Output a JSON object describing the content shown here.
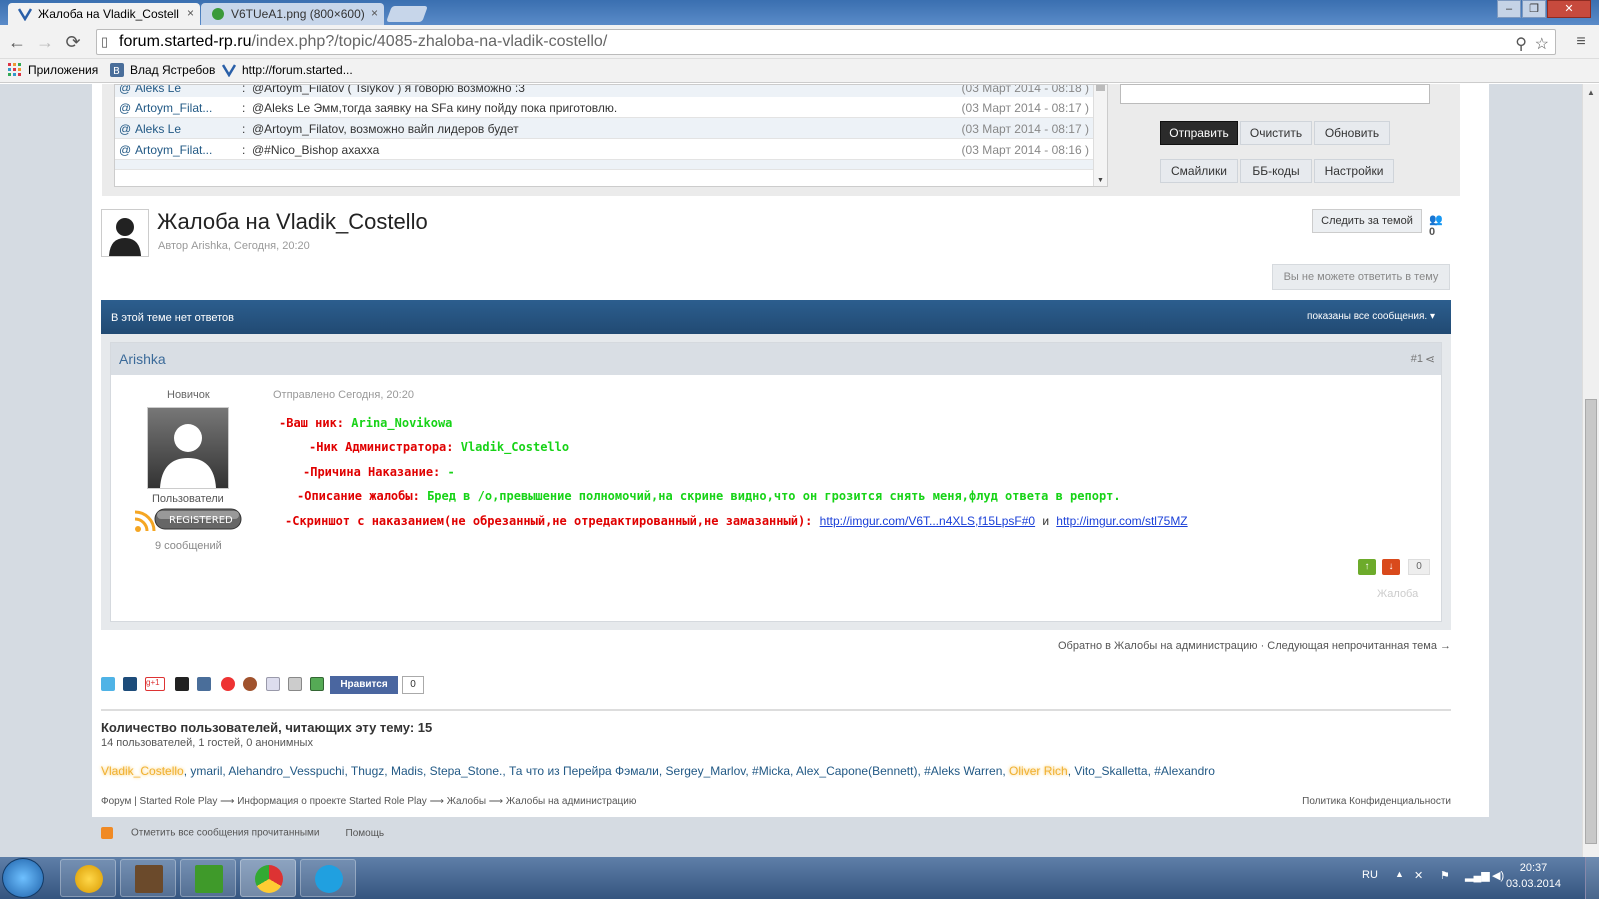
{
  "browser": {
    "tabs": [
      {
        "title": "Жалоба на Vladik_Costell",
        "close": "×"
      },
      {
        "title": "V6TUeA1.png (800×600)",
        "close": "×"
      }
    ],
    "window_controls": {
      "minimize": "‒",
      "restore": "❐",
      "close": "✕"
    },
    "nav": {
      "back": "←",
      "forward": "→",
      "reload": "⟳"
    },
    "url_domain": "forum.started-rp.ru",
    "url_path": "/index.php?/topic/4085-zhaloba-na-vladik-costello/",
    "bookmarks": [
      "Приложения",
      "Влад Ястребов",
      "http://forum.started..."
    ]
  },
  "shoutbox": {
    "rows": [
      {
        "nick": "Aleks Le",
        "msg": "@Artoym_Filatov ( Tsiykov ) я говорю возможно :3",
        "time": "(03 Март 2014 - 08:18 )"
      },
      {
        "nick": "Artoym_Filat...",
        "msg": "@Aleks Le Эмм,тогда заявку на SFa кину пойду пока приготовлю.",
        "time": "(03 Март 2014 - 08:17 )"
      },
      {
        "nick": "Aleks Le",
        "msg": "@Artoym_Filatov, возможно вайп лидеров будет",
        "time": "(03 Март 2014 - 08:17 )"
      },
      {
        "nick": "Artoym_Filat...",
        "msg": "@#Nico_Bishop ахахха",
        "time": "(03 Март 2014 - 08:16 )"
      }
    ],
    "buttons": {
      "send": "Отправить",
      "clear": "Очистить",
      "refresh": "Обновить",
      "smilies": "Смайлики",
      "bbcodes": "ББ-коды",
      "settings": "Настройки"
    }
  },
  "topic": {
    "title": "Жалоба на Vladik_Costello",
    "meta": "Автор Arishka, Сегодня, 20:20",
    "follow": "Следить за темой",
    "followers": "0",
    "cant_reply": "Вы не можете ответить в тему",
    "bar_left": "В этой теме нет ответов",
    "bar_right": "показаны все сообщения."
  },
  "post": {
    "author": "Arishka",
    "number": "#1",
    "rank": "Новичок",
    "group": "Пользователи",
    "badge": "REGISTERED",
    "posts": "9 сообщений",
    "sent": "Отправлено Сегодня, 20:20",
    "l1_label": "-Ваш ник:",
    "l1_value": "Arina_Novikowa",
    "l2_label": "-Ник Администратора:",
    "l2_value": "Vladik_Costello",
    "l3_label": "-Причина Наказание:",
    "l3_value": "-",
    "l4_label": "-Описание жалобы:",
    "l4_value": "Бред в /o,превышение полномочий,на скрине видно,что он грозится снять меня,флуд ответа в репорт.",
    "l5_label": "-Скриншот с наказанием(не обрезанный,не отредактированный,не замазанный):",
    "link1": "http://imgur.com/V6T...n4XLS,f15LpsF#0",
    "link_sep": "и",
    "link2": "http://imgur.com/stl75MZ",
    "vote_up": "↑",
    "vote_down": "↓",
    "votes": "0",
    "tag": "Жалоба"
  },
  "nav_links": "Обратно в Жалобы на администрацию · Следующая непрочитанная тема →",
  "share": {
    "like": "Нравится",
    "count": "0"
  },
  "readers": {
    "title": "Количество пользователей, читающих эту тему: 15",
    "sub": "14 пользователей, 1 гостей, 0 анонимных",
    "hl1": "Vladik_Costello",
    "list_mid": ", ymaril, Alehandro_Vesspuchi, Thugz, Madis, Stepa_Stone., Та что из Перейра Фэмали, Sergey_Marlov, #Micka, Alex_Capone(Bennett), #Aleks Warren, ",
    "hl2": "Oliver Rich",
    "list_end": ", Vito_Skalletta, #Alexandro"
  },
  "breadcrumbs": "Форум | Started Role Play  ⟶  Информация о проекте Started Role Play  ⟶  Жалобы  ⟶  Жалобы на администрацию",
  "privacy": "Политика Конфиденциальности",
  "footer": {
    "mark_read": "Отметить все сообщения прочитанными",
    "help": "Помощь"
  },
  "taskbar": {
    "lang": "RU",
    "time": "20:37",
    "date": "03.03.2014"
  },
  "colors": {
    "accent_blue": "#2c5e8e",
    "red": "#e00000",
    "green": "#17d317"
  }
}
